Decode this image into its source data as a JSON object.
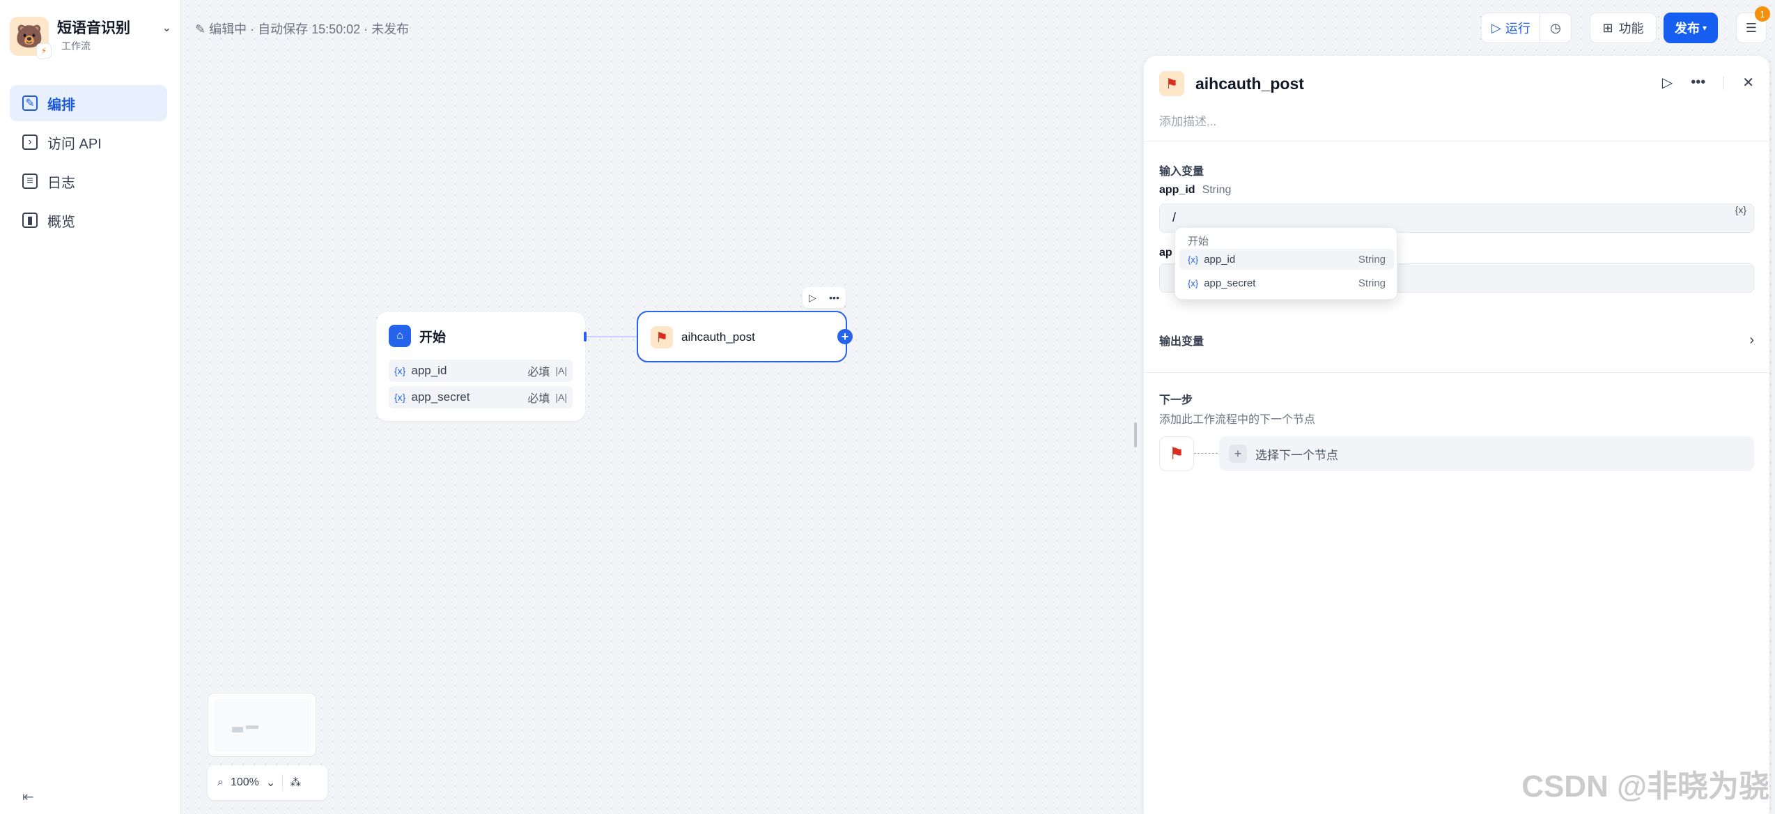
{
  "app": {
    "name": "短语音识别",
    "type": "工作流",
    "avatar": "🐻"
  },
  "nav": [
    {
      "label": "编排",
      "icon": "edit-icon"
    },
    {
      "label": "访问 API",
      "icon": "terminal-icon"
    },
    {
      "label": "日志",
      "icon": "log-icon"
    },
    {
      "label": "概览",
      "icon": "chart-icon"
    }
  ],
  "status": {
    "text": "编辑中 · 自动保存 15:50:02 · 未发布"
  },
  "toolbar": {
    "run": "运行",
    "features": "功能",
    "publish": "发布",
    "badge": "1"
  },
  "canvas": {
    "start_node": {
      "title": "开始",
      "vars": [
        {
          "name": "app_id",
          "required": "必填"
        },
        {
          "name": "app_secret",
          "required": "必填"
        }
      ]
    },
    "post_node": {
      "title": "aihcauth_post"
    },
    "zoom": "100%"
  },
  "panel": {
    "title": "aihcauth_post",
    "description_placeholder": "添加描述...",
    "input_section": "输入变量",
    "field1": {
      "name": "app_id",
      "type": "String",
      "value": "/"
    },
    "field2": {
      "name_partial": "ap"
    },
    "output_section": "输出变量",
    "next_section": "下一步",
    "next_desc": "添加此工作流程中的下一个节点",
    "next_select": "选择下一个节点"
  },
  "dropdown": {
    "group": "开始",
    "items": [
      {
        "name": "app_id",
        "type": "String"
      },
      {
        "name": "app_secret",
        "type": "String"
      }
    ]
  },
  "watermark": "CSDN @非晓为骁"
}
